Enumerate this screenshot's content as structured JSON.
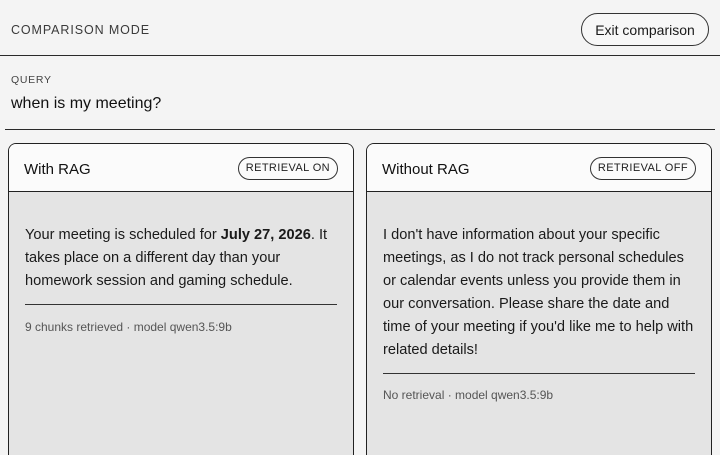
{
  "header": {
    "mode_label": "COMPARISON MODE",
    "exit_button": "Exit comparison"
  },
  "query": {
    "label": "QUERY",
    "text": "when is my meeting?"
  },
  "panels": [
    {
      "title": "With RAG",
      "badge": "RETRIEVAL ON",
      "answer_before": "Your meeting is scheduled for ",
      "answer_bold": "July 27, 2026",
      "answer_after": ". It takes place on a different day than your homework session and gaming schedule.",
      "meta": "9 chunks retrieved · model qwen3.5:9b"
    },
    {
      "title": "Without RAG",
      "badge": "RETRIEVAL OFF",
      "answer": "I don't have information about your specific meetings, as I do not track personal schedules or calendar events unless you provide them in our conversation. Please share the date and time of your meeting if you'd like me to help with related details!",
      "meta": "No retrieval · model qwen3.5:9b"
    }
  ]
}
